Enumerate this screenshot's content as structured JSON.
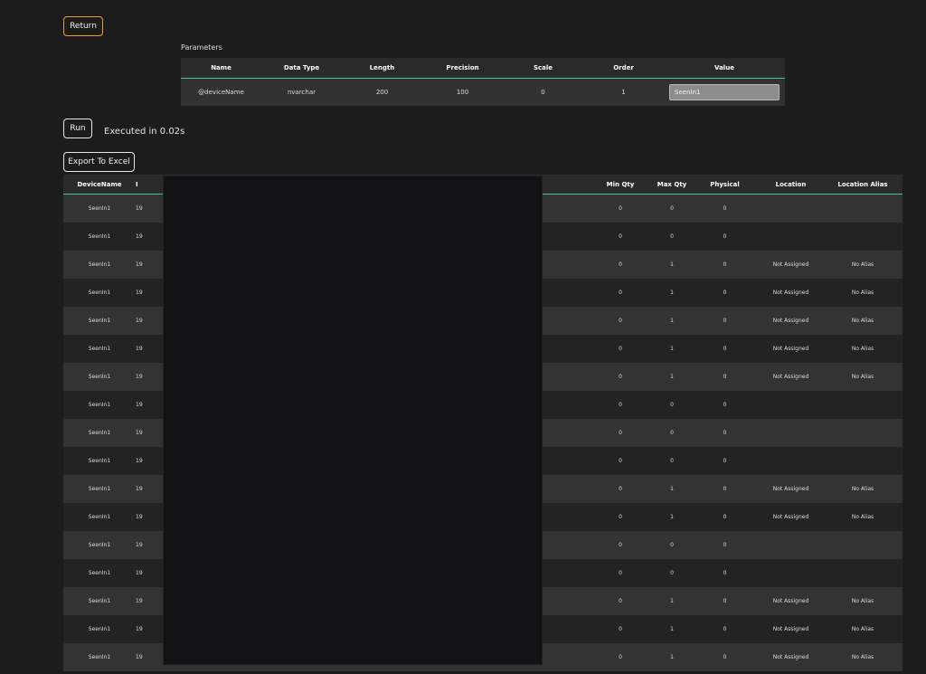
{
  "buttons": {
    "return": "Return",
    "run": "Run",
    "export": "Export To Excel"
  },
  "status": {
    "executed": "Executed in 0.02s"
  },
  "parameters": {
    "label": "Parameters",
    "headers": [
      "Name",
      "Data Type",
      "Length",
      "Precision",
      "Scale",
      "Order",
      "Value"
    ],
    "row": {
      "name": "@deviceName",
      "data_type": "nvarchar",
      "length": "200",
      "precision": "100",
      "scale": "0",
      "order": "1",
      "value": "SeenIn1"
    }
  },
  "results": {
    "headers": {
      "device": "DeviceName",
      "id": "I",
      "min": "Min Qty",
      "max": "Max Qty",
      "physical": "Physical",
      "location": "Location",
      "alias": "Location Alias"
    },
    "rows": [
      {
        "device": "SeenIn1",
        "id": "19",
        "min": "0",
        "max": "0",
        "physical": "0",
        "location": "",
        "alias": ""
      },
      {
        "device": "SeenIn1",
        "id": "19",
        "min": "0",
        "max": "0",
        "physical": "0",
        "location": "",
        "alias": ""
      },
      {
        "device": "SeenIn1",
        "id": "19",
        "min": "0",
        "max": "1",
        "physical": "0",
        "location": "Not Assigned",
        "alias": "No Alias"
      },
      {
        "device": "SeenIn1",
        "id": "19",
        "min": "0",
        "max": "1",
        "physical": "0",
        "location": "Not Assigned",
        "alias": "No Alias"
      },
      {
        "device": "SeenIn1",
        "id": "19",
        "min": "0",
        "max": "1",
        "physical": "0",
        "location": "Not Assigned",
        "alias": "No Alias"
      },
      {
        "device": "SeenIn1",
        "id": "19",
        "min": "0",
        "max": "1",
        "physical": "0",
        "location": "Not Assigned",
        "alias": "No Alias"
      },
      {
        "device": "SeenIn1",
        "id": "19",
        "min": "0",
        "max": "1",
        "physical": "0",
        "location": "Not Assigned",
        "alias": "No Alias"
      },
      {
        "device": "SeenIn1",
        "id": "19",
        "min": "0",
        "max": "0",
        "physical": "0",
        "location": "",
        "alias": ""
      },
      {
        "device": "SeenIn1",
        "id": "19",
        "min": "0",
        "max": "0",
        "physical": "0",
        "location": "",
        "alias": ""
      },
      {
        "device": "SeenIn1",
        "id": "19",
        "min": "0",
        "max": "0",
        "physical": "0",
        "location": "",
        "alias": ""
      },
      {
        "device": "SeenIn1",
        "id": "19",
        "min": "0",
        "max": "1",
        "physical": "0",
        "location": "Not Assigned",
        "alias": "No Alias"
      },
      {
        "device": "SeenIn1",
        "id": "19",
        "min": "0",
        "max": "1",
        "physical": "0",
        "location": "Not Assigned",
        "alias": "No Alias"
      },
      {
        "device": "SeenIn1",
        "id": "19",
        "min": "0",
        "max": "0",
        "physical": "0",
        "location": "",
        "alias": ""
      },
      {
        "device": "SeenIn1",
        "id": "19",
        "min": "0",
        "max": "0",
        "physical": "0",
        "location": "",
        "alias": ""
      },
      {
        "device": "SeenIn1",
        "id": "19",
        "min": "0",
        "max": "1",
        "physical": "0",
        "location": "Not Assigned",
        "alias": "No Alias"
      },
      {
        "device": "SeenIn1",
        "id": "19",
        "min": "0",
        "max": "1",
        "physical": "0",
        "location": "Not Assigned",
        "alias": "No Alias"
      },
      {
        "device": "SeenIn1",
        "id": "19",
        "min": "0",
        "max": "1",
        "physical": "0",
        "location": "Not Assigned",
        "alias": "No Alias"
      }
    ]
  }
}
